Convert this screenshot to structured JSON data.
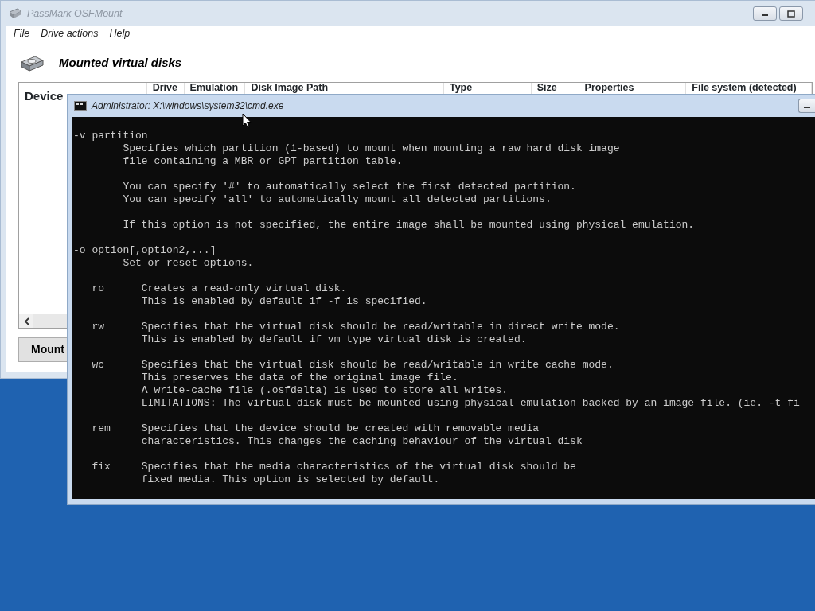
{
  "osfmount": {
    "title": "PassMark OSFMount",
    "menu": [
      "File",
      "Drive actions",
      "Help"
    ],
    "heading": "Mounted virtual disks",
    "columns": [
      "Device",
      "Drive",
      "Emulation",
      "Disk Image Path",
      "Type",
      "Size",
      "Properties",
      "File system (detected)"
    ],
    "mount_button": "Mount"
  },
  "cmd": {
    "title": "Administrator: X:\\windows\\system32\\cmd.exe",
    "blocks": [
      [
        "-v partition",
        "        Specifies which partition (1-based) to mount when mounting a raw hard disk image",
        "        file containing a MBR or GPT partition table."
      ],
      [
        "        You can specify '#' to automatically select the first detected partition.",
        "        You can specify 'all' to automatically mount all detected partitions."
      ],
      [
        "        If this option is not specified, the entire image shall be mounted using physical emulation."
      ],
      [
        "-o option[,option2,...]",
        "        Set or reset options."
      ],
      [
        "   ro      Creates a read-only virtual disk.",
        "           This is enabled by default if -f is specified."
      ],
      [
        "   rw      Specifies that the virtual disk should be read/writable in direct write mode.",
        "           This is enabled by default if vm type virtual disk is created."
      ],
      [
        "   wc      Specifies that the virtual disk should be read/writable in write cache mode.",
        "           This preserves the data of the original image file.",
        "           A write-cache file (.osfdelta) is used to store all writes.",
        "           LIMITATIONS: The virtual disk must be mounted using physical emulation backed by an image file. (ie. -t fi"
      ],
      [
        "   rem     Specifies that the device should be created with removable media",
        "           characteristics. This changes the caching behaviour of the virtual disk"
      ],
      [
        "   fix     Specifies that the media characteristics of the virtual disk should be",
        "           fixed media. This option is selected by default."
      ]
    ]
  }
}
